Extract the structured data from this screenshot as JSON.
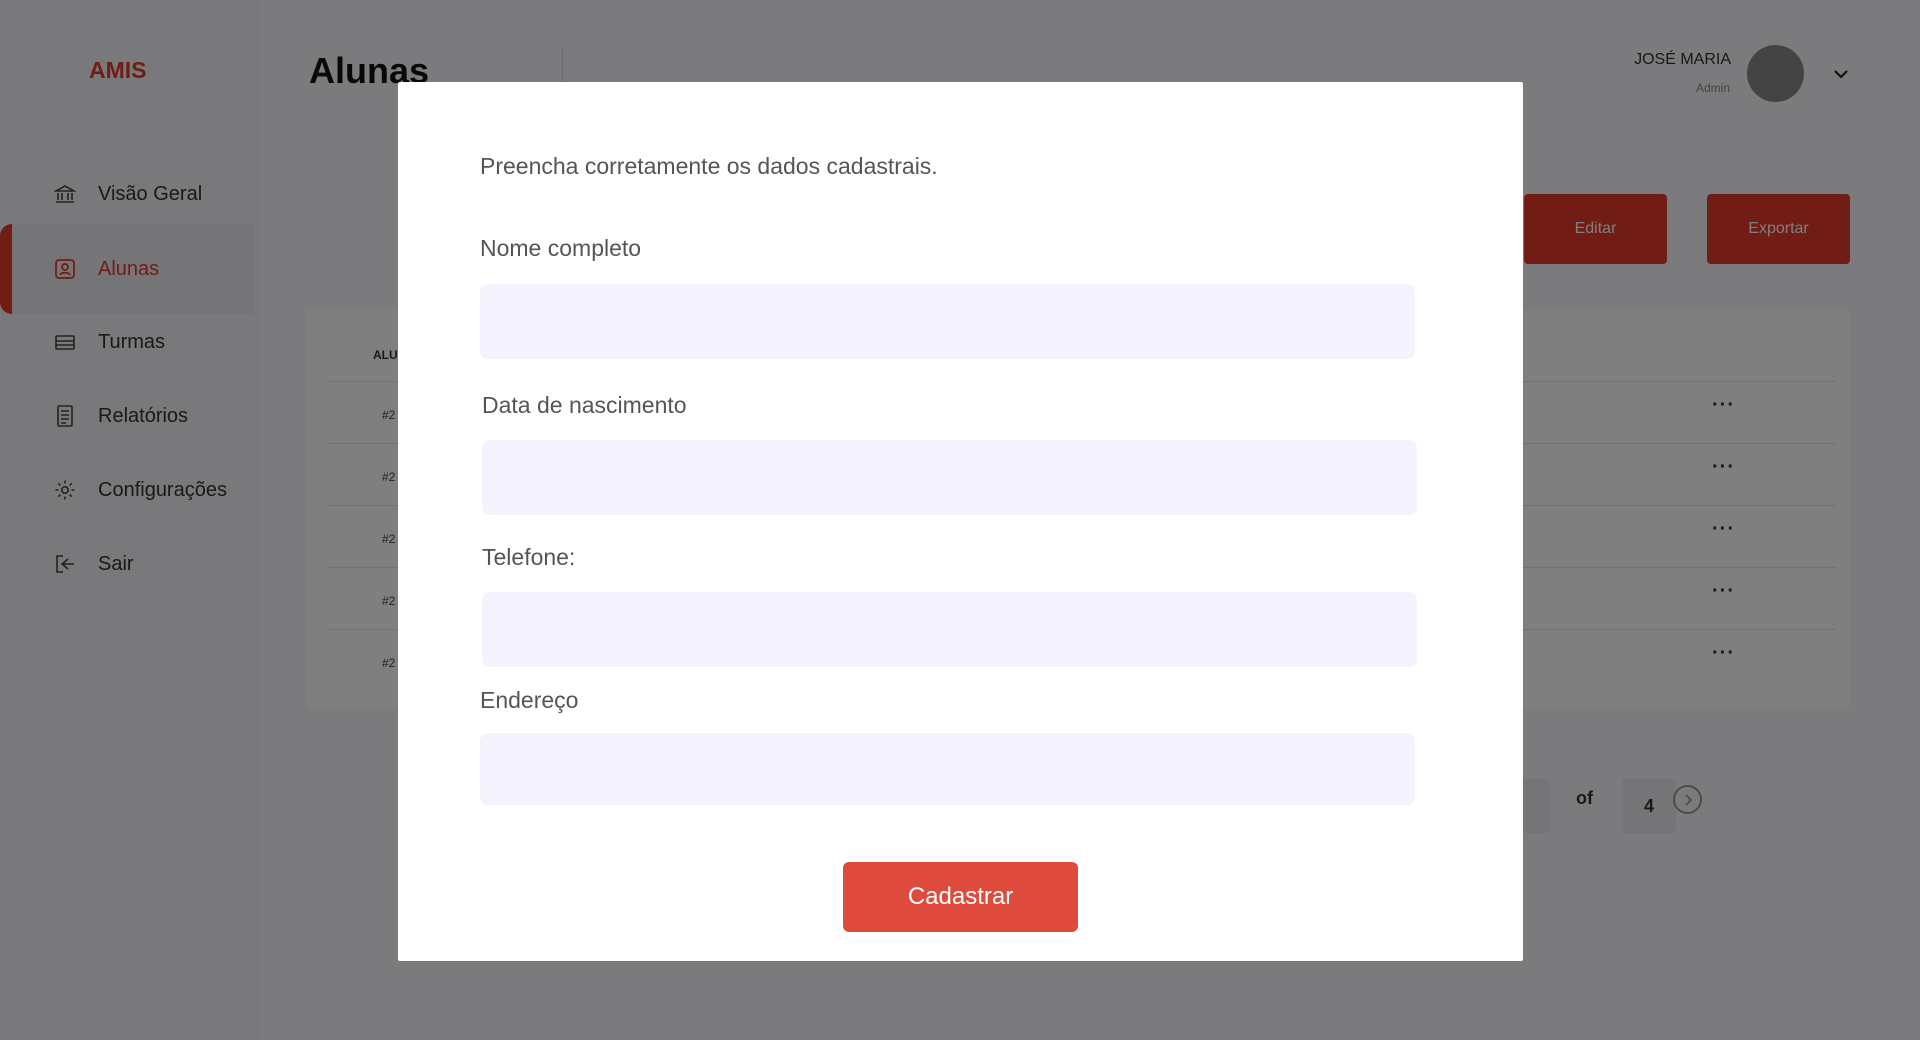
{
  "app": {
    "logo": "AMIS",
    "accent": "#e23a2b"
  },
  "sidebar": {
    "items": [
      {
        "label": "Visão Geral",
        "icon": "bank-icon"
      },
      {
        "label": "Alunas",
        "icon": "contact-card-icon",
        "active": true
      },
      {
        "label": "Turmas",
        "icon": "layers-icon"
      },
      {
        "label": "Relatórios",
        "icon": "report-icon"
      },
      {
        "label": "Configurações",
        "icon": "gear-icon"
      },
      {
        "label": "Sair",
        "icon": "logout-icon"
      }
    ]
  },
  "header": {
    "title": "Alunas",
    "user": {
      "name": "JOSÉ MARIA",
      "role": "Admin"
    }
  },
  "toolbar": {
    "edit_label": "Editar",
    "export_label": "Exportar"
  },
  "table": {
    "header": "ALUNA",
    "rows": [
      "#2",
      "#2",
      "#2",
      "#2",
      "#2"
    ]
  },
  "pagination": {
    "of_label": "of",
    "total": "4"
  },
  "modal": {
    "intro": "Preencha corretamente os dados cadastrais.",
    "fields": [
      {
        "label": "Nome completo",
        "value": ""
      },
      {
        "label": "Data de nascimento",
        "value": ""
      },
      {
        "label": "Telefone:",
        "value": ""
      },
      {
        "label": "Endereço",
        "value": ""
      }
    ],
    "submit_label": "Cadastrar"
  }
}
